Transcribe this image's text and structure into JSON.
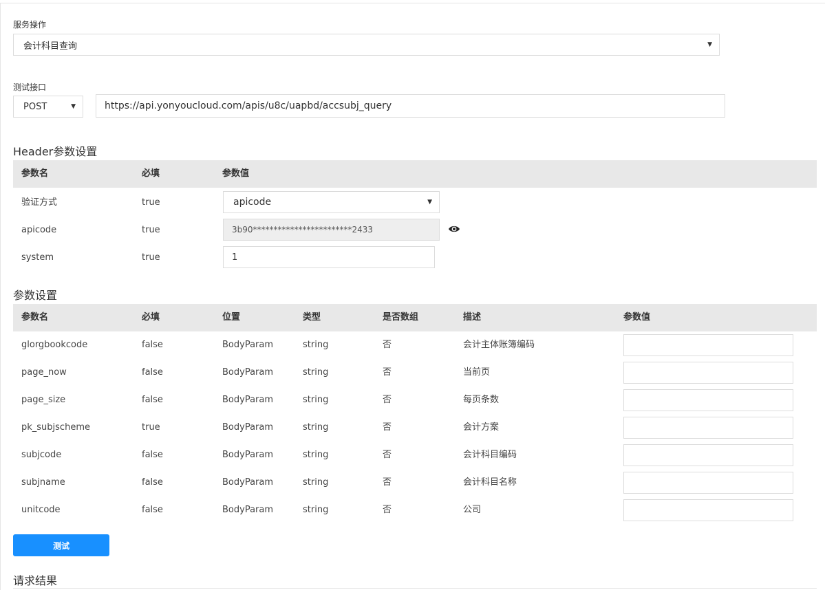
{
  "service": {
    "label": "服务操作",
    "selected": "会计科目查询"
  },
  "endpoint": {
    "label": "测试接口",
    "method": "POST",
    "url": "https://api.yonyoucloud.com/apis/u8c/uapbd/accsubj_query"
  },
  "header_section": {
    "title": "Header参数设置",
    "columns": [
      "参数名",
      "必填",
      "参数值"
    ],
    "rows": [
      {
        "name": "验证方式",
        "required": "true",
        "value": "apicode"
      },
      {
        "name": "apicode",
        "required": "true",
        "value": "3b90************************2433"
      },
      {
        "name": "system",
        "required": "true",
        "value": "1"
      }
    ]
  },
  "params_section": {
    "title": "参数设置",
    "columns": [
      "参数名",
      "必填",
      "位置",
      "类型",
      "是否数组",
      "描述",
      "参数值"
    ],
    "rows": [
      {
        "name": "glorgbookcode",
        "required": "false",
        "position": "BodyParam",
        "type": "string",
        "is_array": "否",
        "description": "会计主体账簿编码",
        "value": ""
      },
      {
        "name": "page_now",
        "required": "false",
        "position": "BodyParam",
        "type": "string",
        "is_array": "否",
        "description": "当前页",
        "value": ""
      },
      {
        "name": "page_size",
        "required": "false",
        "position": "BodyParam",
        "type": "string",
        "is_array": "否",
        "description": "每页条数",
        "value": ""
      },
      {
        "name": "pk_subjscheme",
        "required": "true",
        "position": "BodyParam",
        "type": "string",
        "is_array": "否",
        "description": "会计方案",
        "value": ""
      },
      {
        "name": "subjcode",
        "required": "false",
        "position": "BodyParam",
        "type": "string",
        "is_array": "否",
        "description": "会计科目编码",
        "value": ""
      },
      {
        "name": "subjname",
        "required": "false",
        "position": "BodyParam",
        "type": "string",
        "is_array": "否",
        "description": "会计科目名称",
        "value": ""
      },
      {
        "name": "unitcode",
        "required": "false",
        "position": "BodyParam",
        "type": "string",
        "is_array": "否",
        "description": "公司",
        "value": ""
      }
    ]
  },
  "actions": {
    "test_label": "测试"
  },
  "result": {
    "title": "请求结果"
  },
  "icons": {
    "eye": "eye-icon",
    "caret": "caret-down-icon"
  },
  "colors": {
    "primary": "#1890ff",
    "table_header_bg": "#e8e8e8",
    "disabled_input_bg": "#eeeeee"
  }
}
